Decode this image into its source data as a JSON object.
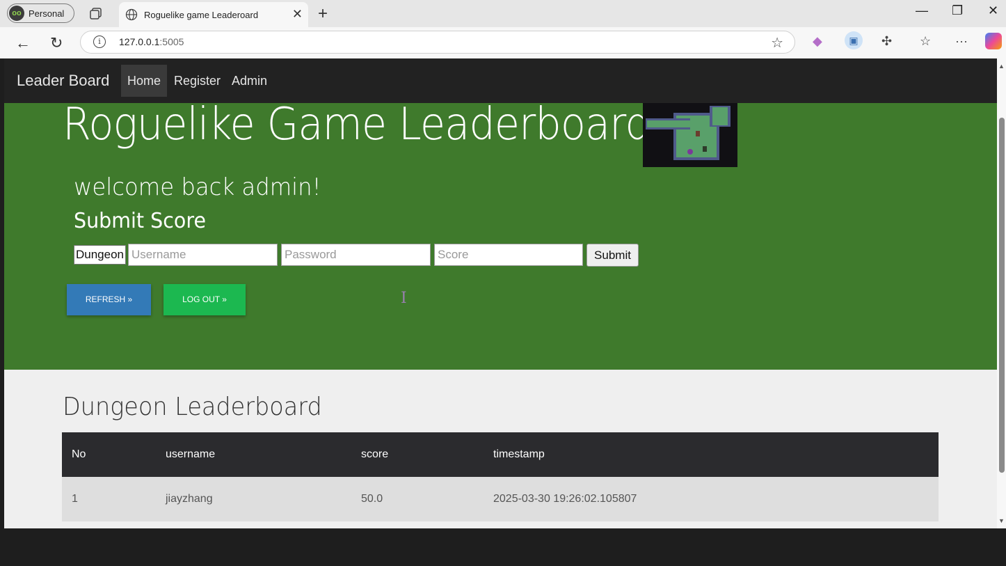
{
  "browser": {
    "profile_label": "Personal",
    "tab_title": "Roguelike game Leaderoard",
    "url_host": "127.0.0.1",
    "url_port": ":5005"
  },
  "navbar": {
    "brand": "Leader Board",
    "links": [
      "Home",
      "Register",
      "Admin"
    ]
  },
  "hero": {
    "title": "Roguelike Game Leaderboard",
    "welcome": "welcome back admin!",
    "submit_heading": "Submit Score",
    "game_select_value": "Dungeon",
    "username_placeholder": "Username",
    "password_placeholder": "Password",
    "score_placeholder": "Score",
    "submit_label": "Submit",
    "refresh_label": "REFRESH »",
    "logout_label": "LOG OUT »",
    "background_color": "#3f7a2c"
  },
  "leaderboard": {
    "title": "Dungeon Leaderboard",
    "headers": [
      "No",
      "username",
      "score",
      "timestamp"
    ],
    "rows": [
      [
        "1",
        "jiayzhang",
        "50.0",
        "2025-03-30 19:26:02.105807"
      ]
    ]
  },
  "colors": {
    "refresh_button": "#337ab7",
    "logout_button": "#1cb850",
    "navbar": "#222222"
  }
}
